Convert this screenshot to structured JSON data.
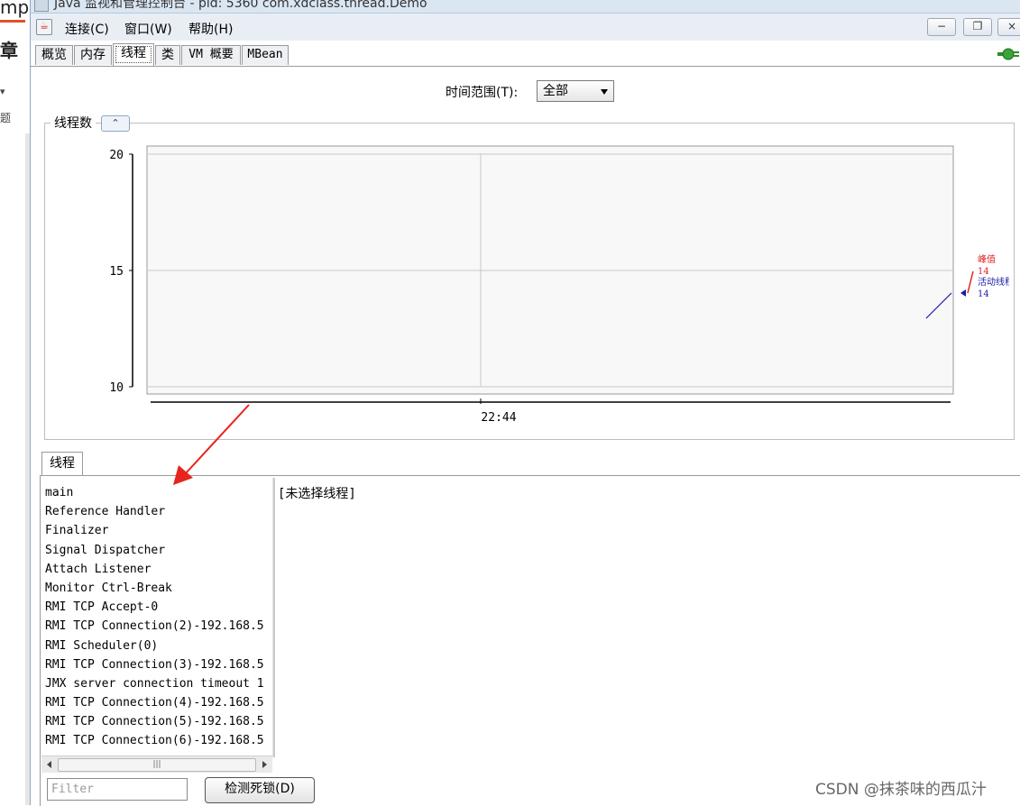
{
  "window": {
    "title": "Java 监视和管理控制台 - pid: 5360 com.xdclass.thread.Demo"
  },
  "background_page": {
    "fragment_top": "mp",
    "fragment_heading": "章",
    "fragment_small": "▾",
    "fragment_small2": "题"
  },
  "menu": {
    "items": [
      {
        "label": "连接(C)"
      },
      {
        "label": "窗口(W)"
      },
      {
        "label": "帮助(H)"
      }
    ],
    "minimize": "−",
    "restore": "❐",
    "close": "×"
  },
  "tabs": [
    {
      "label": "概览"
    },
    {
      "label": "内存"
    },
    {
      "label": "线程"
    },
    {
      "label": "类"
    },
    {
      "label": "VM 概要"
    },
    {
      "label": "MBean"
    }
  ],
  "time_range": {
    "label": "时间范围(T):",
    "selected": "全部"
  },
  "chart_panel": {
    "legend_title": "线程数",
    "collapse_glyph": "⌃"
  },
  "chart_data": {
    "type": "line",
    "yticks": [
      "20",
      "15",
      "10"
    ],
    "ylim": [
      10,
      20
    ],
    "xticks": [
      "22:44"
    ],
    "series": [
      {
        "name": "峰值",
        "last_value": "14",
        "color": "#e02020"
      },
      {
        "name": "活动线程",
        "last_value": "14",
        "color": "#1a1aa6"
      }
    ],
    "grid": true
  },
  "threads_tab": {
    "label": "线程",
    "items": [
      "main",
      "Reference Handler",
      "Finalizer",
      "Signal Dispatcher",
      "Attach Listener",
      "Monitor Ctrl-Break",
      "RMI TCP Accept-0",
      "RMI TCP Connection(2)-192.168.5",
      "RMI Scheduler(0)",
      "RMI TCP Connection(3)-192.168.5",
      "JMX server connection timeout 1",
      "RMI TCP Connection(4)-192.168.5",
      "RMI TCP Connection(5)-192.168.5",
      "RMI TCP Connection(6)-192.168.5"
    ],
    "detail_placeholder": "[未选择线程]",
    "scroll_thumb": "|||",
    "filter_placeholder": "Filter",
    "deadlock_button": "检测死锁(D)"
  },
  "watermark": "CSDN @抹茶味的西瓜汁",
  "colors": {
    "peak": "#e02020",
    "live": "#1a1aa6",
    "arrow": "#e8241c"
  }
}
